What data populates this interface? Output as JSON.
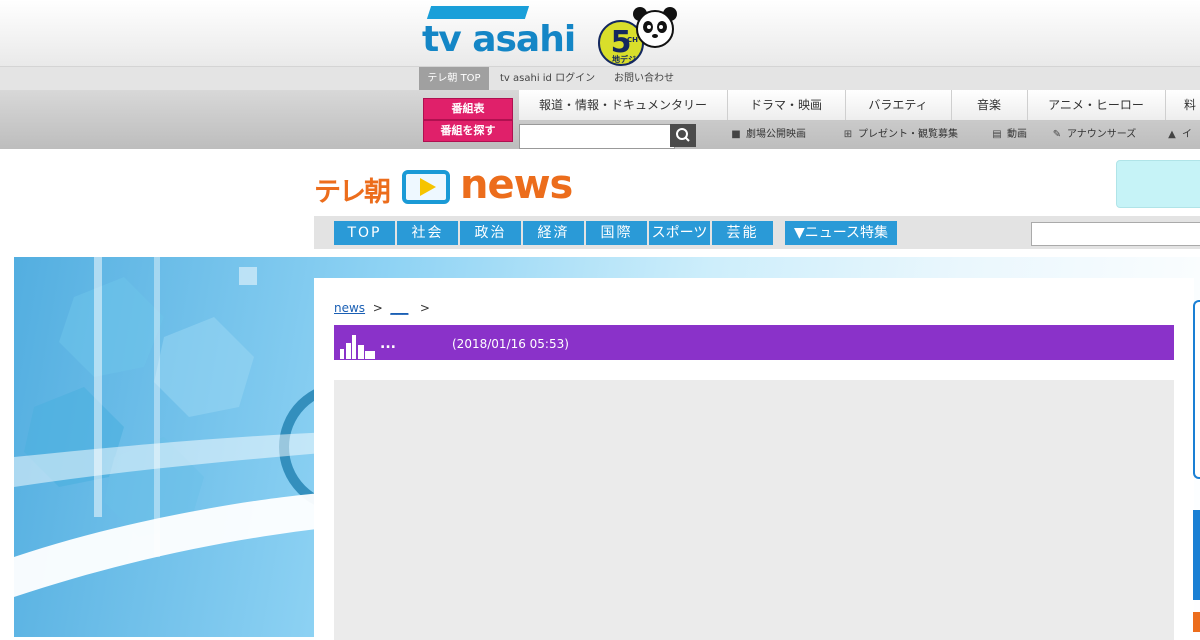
{
  "brand": {
    "logo_text": "tv asahi",
    "channel_number": "5",
    "channel_suffix": "CH",
    "channel_sub": "地デジ",
    "accent_blue": "#1486c6",
    "accent_pink": "#e0206a"
  },
  "subnav": {
    "items": [
      "テレ朝 TOP",
      "tv asahi id ログイン",
      "お問い合わせ"
    ]
  },
  "mainnav": {
    "buttons": [
      "番組表",
      "番組を探す"
    ],
    "categories": [
      "報道・情報・ドキュメンタリー",
      "ドラマ・映画",
      "バラエティ",
      "音楽",
      "アニメ・ヒーロー",
      "料"
    ],
    "search": {
      "placeholder": "",
      "icon": "search-icon"
    },
    "utility_links": [
      {
        "label": "劇場公開映画",
        "icon": "video-camera-icon"
      },
      {
        "label": "プレゼント・観覧募集",
        "icon": "gift-icon"
      },
      {
        "label": "動画",
        "icon": "film-icon"
      },
      {
        "label": "アナウンサーズ",
        "icon": "microphone-icon"
      },
      {
        "label": "イ",
        "icon": "person-icon"
      }
    ]
  },
  "news": {
    "logo_prefix": "テレ朝",
    "logo_word": "news",
    "accent_orange": "#ec6d1c",
    "tabs": [
      "TOP",
      "社会",
      "政治",
      "経済",
      "国際",
      "スポーツ",
      "芸能"
    ],
    "special_tab": "▼ニュース特集",
    "tab_color": "#2a9ad7"
  },
  "article": {
    "breadcrumb": {
      "home": "news",
      "sep": ">",
      "section": "___",
      "sep2": ">"
    },
    "title": "...",
    "date": "(2018/01/16 05:53)",
    "header_color": "#8a32c9"
  }
}
